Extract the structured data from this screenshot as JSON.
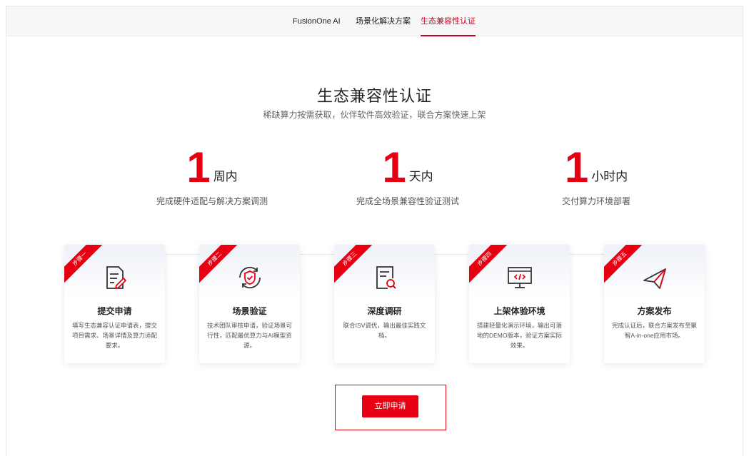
{
  "tabs": [
    {
      "label": "FusionOne AI",
      "active": false
    },
    {
      "label": "场景化解决方案",
      "active": false
    },
    {
      "label": "生态兼容性认证",
      "active": true
    }
  ],
  "header": {
    "title": "生态兼容性认证",
    "subtitle": "稀缺算力按需获取，伙伴软件高效验证，联合方案快速上架"
  },
  "stats": [
    {
      "number": "1",
      "unit": "周内",
      "desc": "完成硬件适配与解决方案调测"
    },
    {
      "number": "1",
      "unit": "天内",
      "desc": "完成全场景兼容性验证测试"
    },
    {
      "number": "1",
      "unit": "小时内",
      "desc": "交付算力环境部署"
    }
  ],
  "steps": [
    {
      "badge": "步骤一",
      "icon": "document-edit-icon",
      "title": "提交申请",
      "desc": "填写生态兼容认证申请表，提交项目需求、场景详情及算力适配要求。"
    },
    {
      "badge": "步骤二",
      "icon": "shield-check-icon",
      "title": "场景验证",
      "desc": "技术团队审核申请，验证场景可行性，匹配最优算力与AI模型资源。"
    },
    {
      "badge": "步骤三",
      "icon": "document-search-icon",
      "title": "深度调研",
      "desc": "联合ISV调优，输出最佳实践文档。"
    },
    {
      "badge": "步骤四",
      "icon": "monitor-code-icon",
      "title": "上架体验环境",
      "desc": "搭建轻量化演示环境，输出可落地的DEMO版本，验证方案实际效果。"
    },
    {
      "badge": "步骤五",
      "icon": "paper-plane-icon",
      "title": "方案发布",
      "desc": "完成认证后，联合方案发布至聚智A-in-one应用市场。"
    }
  ],
  "cta": {
    "label": "立即申请"
  },
  "colors": {
    "accent": "#e60012",
    "tab_active": "#d0021b"
  }
}
